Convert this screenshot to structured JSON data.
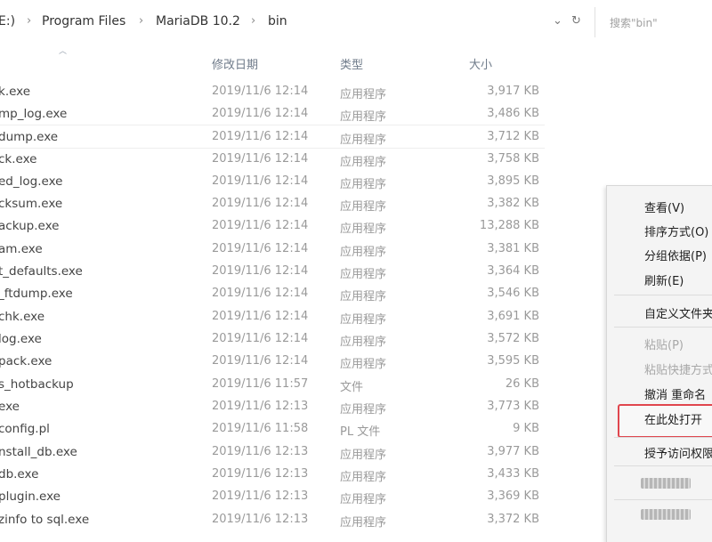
{
  "address_bar": {
    "crumbs": [
      "E:)",
      "Program Files",
      "MariaDB 10.2",
      "bin"
    ],
    "search_placeholder": "搜索\"bin\""
  },
  "icons": {
    "breadcrumb_separator": "chevron-right-icon",
    "dropdown": "chevron-down-icon",
    "refresh": "refresh-icon",
    "sort": "sort-up-icon"
  },
  "columns": {
    "date": "修改日期",
    "type": "类型",
    "size": "大小"
  },
  "files": [
    {
      "name": "k.exe",
      "date": "2019/11/6 12:14",
      "type": "应用程序",
      "size": "3,917 KB"
    },
    {
      "name": "mp_log.exe",
      "date": "2019/11/6 12:14",
      "type": "应用程序",
      "size": "3,486 KB"
    },
    {
      "name": "dump.exe",
      "date": "2019/11/6 12:14",
      "type": "应用程序",
      "size": "3,712 KB"
    },
    {
      "name": "ck.exe",
      "date": "2019/11/6 12:14",
      "type": "应用程序",
      "size": "3,758 KB"
    },
    {
      "name": "ed_log.exe",
      "date": "2019/11/6 12:14",
      "type": "应用程序",
      "size": "3,895 KB"
    },
    {
      "name": "cksum.exe",
      "date": "2019/11/6 12:14",
      "type": "应用程序",
      "size": "3,382 KB"
    },
    {
      "name": "ackup.exe",
      "date": "2019/11/6 12:14",
      "type": "应用程序",
      "size": "13,288 KB"
    },
    {
      "name": "am.exe",
      "date": "2019/11/6 12:14",
      "type": "应用程序",
      "size": "3,381 KB"
    },
    {
      "name": "t_defaults.exe",
      "date": "2019/11/6 12:14",
      "type": "应用程序",
      "size": "3,364 KB"
    },
    {
      "name": "_ftdump.exe",
      "date": "2019/11/6 12:14",
      "type": "应用程序",
      "size": "3,546 KB"
    },
    {
      "name": "chk.exe",
      "date": "2019/11/6 12:14",
      "type": "应用程序",
      "size": "3,691 KB"
    },
    {
      "name": "log.exe",
      "date": "2019/11/6 12:14",
      "type": "应用程序",
      "size": "3,572 KB"
    },
    {
      "name": "pack.exe",
      "date": "2019/11/6 12:14",
      "type": "应用程序",
      "size": "3,595 KB"
    },
    {
      "name": "s_hotbackup",
      "date": "2019/11/6 11:57",
      "type": "文件",
      "size": "26 KB"
    },
    {
      "name": "exe",
      "date": "2019/11/6 12:13",
      "type": "应用程序",
      "size": "3,773 KB"
    },
    {
      "name": "config.pl",
      "date": "2019/11/6 11:58",
      "type": "PL 文件",
      "size": "9 KB"
    },
    {
      "name": "nstall_db.exe",
      "date": "2019/11/6 12:13",
      "type": "应用程序",
      "size": "3,977 KB"
    },
    {
      "name": "db.exe",
      "date": "2019/11/6 12:13",
      "type": "应用程序",
      "size": "3,433 KB"
    },
    {
      "name": "plugin.exe",
      "date": "2019/11/6 12:13",
      "type": "应用程序",
      "size": "3,369 KB"
    },
    {
      "name": "zinfo to sql.exe",
      "date": "2019/11/6 12:13",
      "type": "应用程序",
      "size": "3,372 KB"
    }
  ],
  "context_menu": {
    "view": "查看(V)",
    "sort": "排序方式(O)",
    "group": "分组依据(P)",
    "refresh": "刷新(E)",
    "customize": "自定义文件夹",
    "paste": "粘贴(P)",
    "paste_shortcut": "粘贴快捷方式",
    "undo_rename": "撤消 重命名",
    "open_here": "在此处打开",
    "grant_access": "授予访问权限"
  },
  "highlight_color": "#e0464e"
}
